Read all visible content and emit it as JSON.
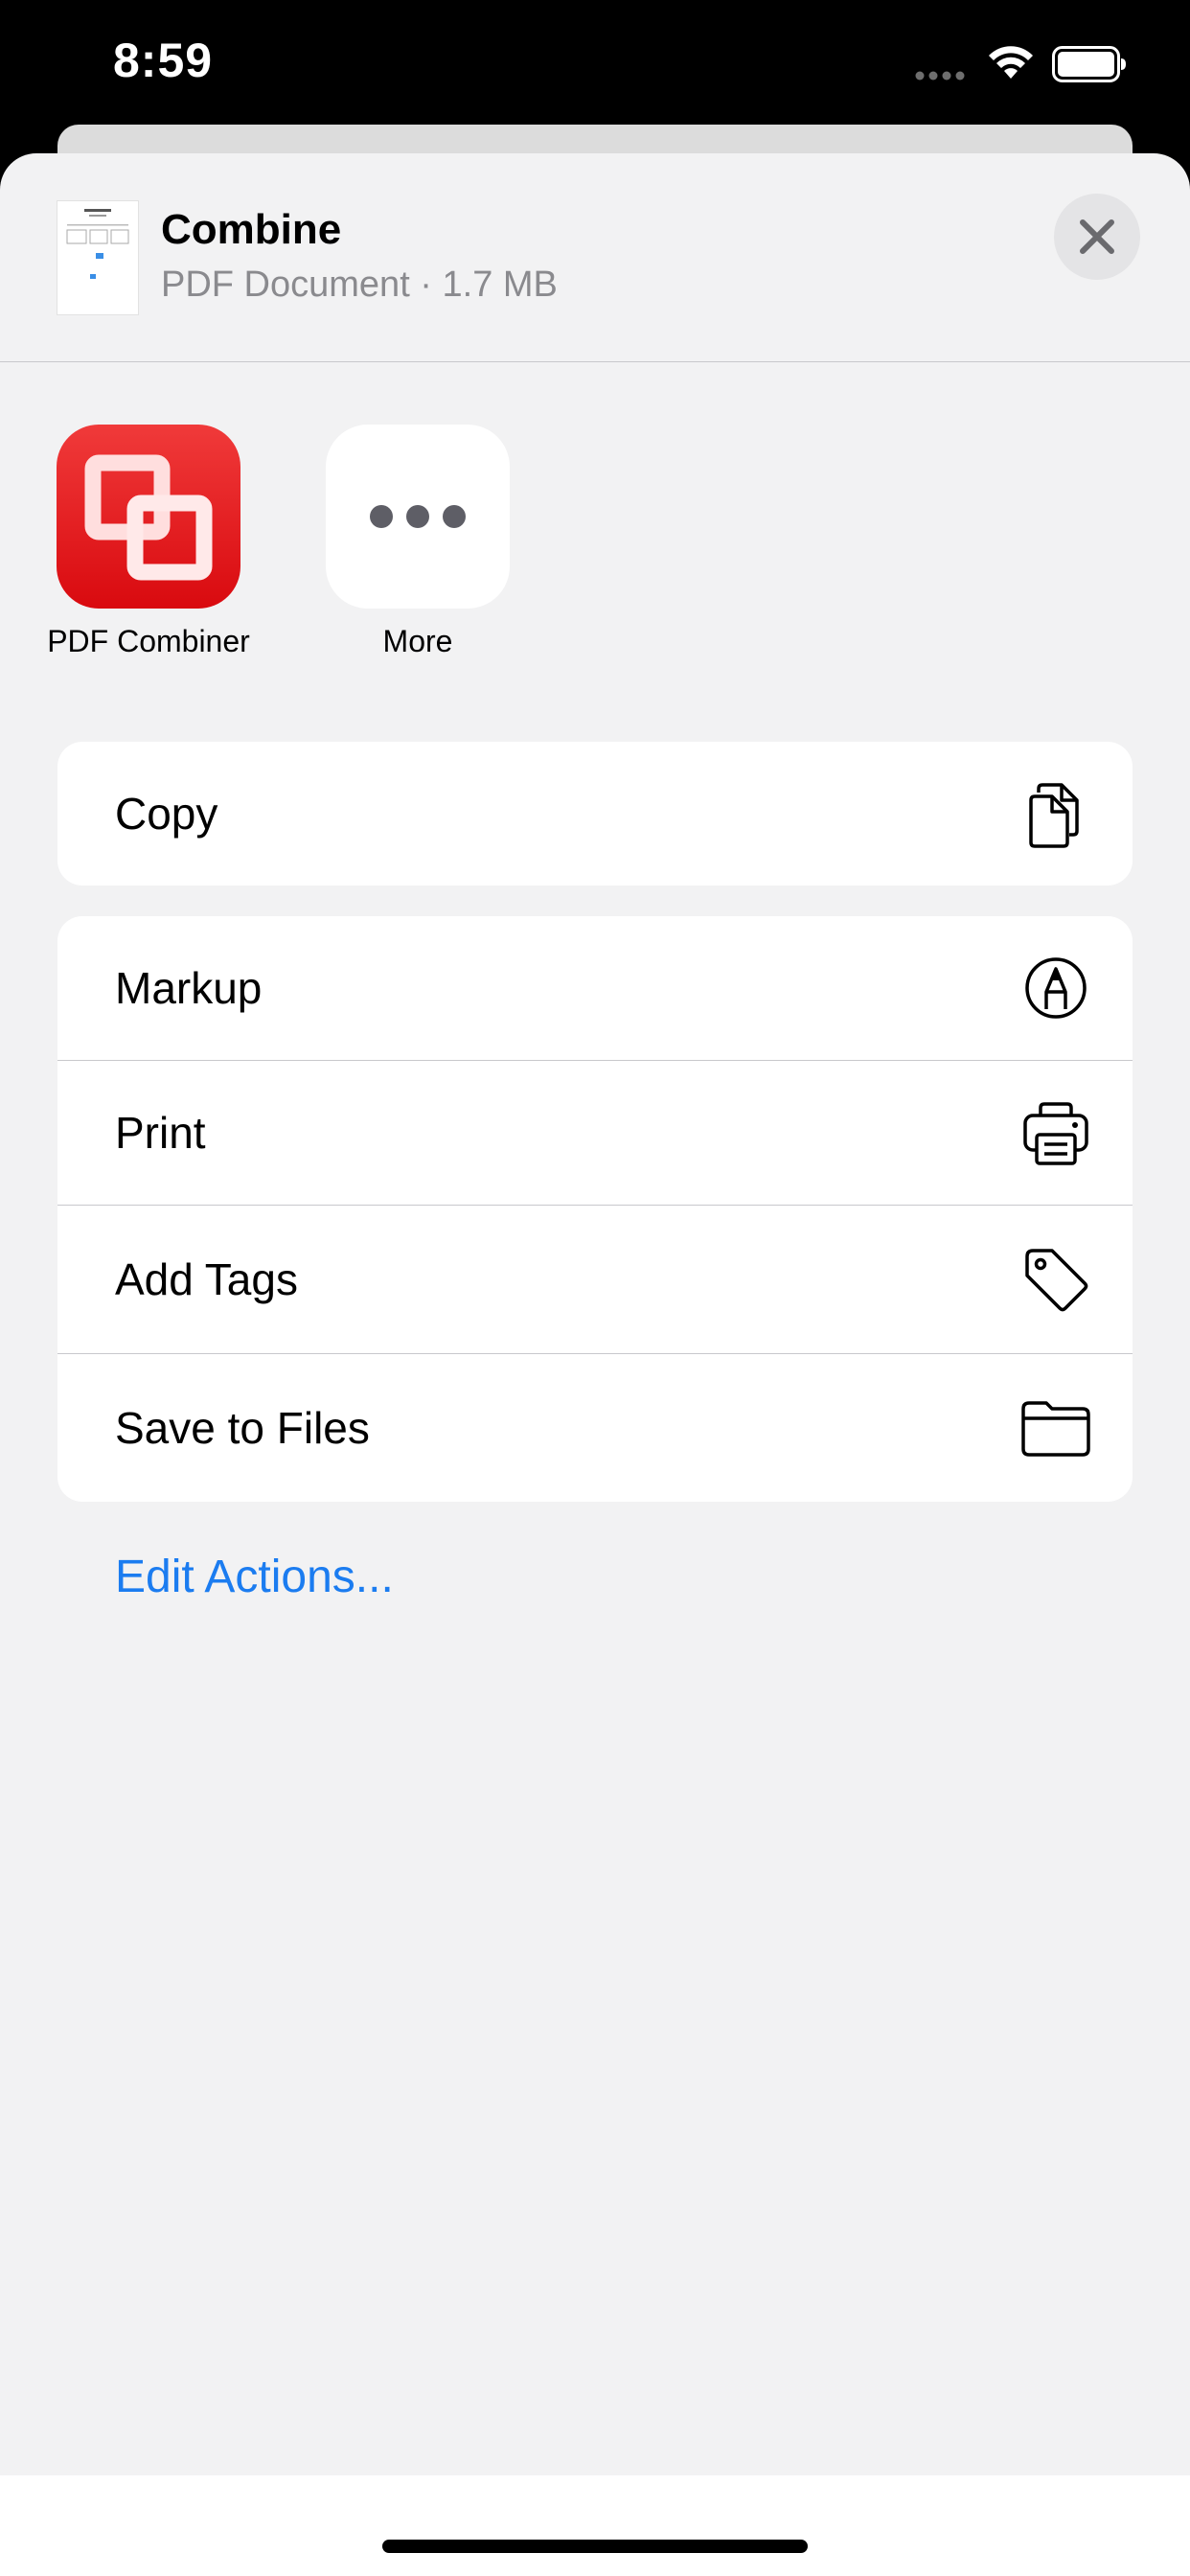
{
  "status_bar": {
    "time": "8:59"
  },
  "header": {
    "title": "Combine",
    "subtitle": "PDF Document · 1.7 MB"
  },
  "apps": [
    {
      "label": "PDF Combiner",
      "icon": "pdf-combiner-app-icon"
    },
    {
      "label": "More",
      "icon": "more-icon"
    }
  ],
  "actions": {
    "copy": {
      "label": "Copy",
      "icon": "copy-icon"
    },
    "markup": {
      "label": "Markup",
      "icon": "markup-icon"
    },
    "print": {
      "label": "Print",
      "icon": "printer-icon"
    },
    "add_tags": {
      "label": "Add Tags",
      "icon": "tag-icon"
    },
    "save_to_files": {
      "label": "Save to Files",
      "icon": "folder-icon"
    }
  },
  "edit_actions": "Edit Actions...",
  "colors": {
    "accent": "#1b7cf0",
    "sheet_background": "#f2f2f3",
    "app_red": "#e01b1f"
  }
}
